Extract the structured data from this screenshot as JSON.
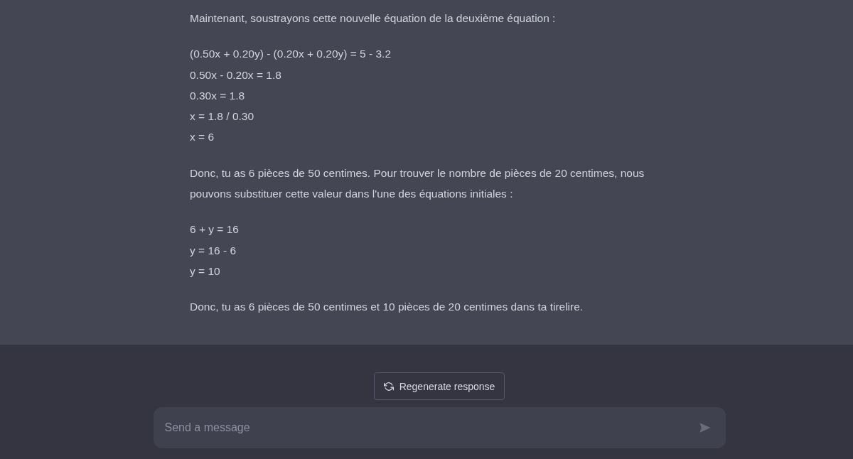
{
  "message": {
    "blocks": [
      {
        "kind": "paragraph",
        "text": "Maintenant, soustrayons cette nouvelle équation de la deuxième équation :"
      },
      {
        "kind": "lines",
        "lines": [
          "(0.50x + 0.20y) - (0.20x + 0.20y) = 5 - 3.2",
          "0.50x - 0.20x = 1.8",
          "0.30x = 1.8",
          "x = 1.8 / 0.30",
          "x = 6"
        ]
      },
      {
        "kind": "paragraph",
        "text": "Donc, tu as 6 pièces de 50 centimes. Pour trouver le nombre de pièces de 20 centimes, nous pouvons substituer cette valeur dans l'une des équations initiales :"
      },
      {
        "kind": "lines",
        "lines": [
          "6 + y = 16",
          "y = 16 - 6",
          "y = 10"
        ]
      },
      {
        "kind": "paragraph",
        "text": "Donc, tu as 6 pièces de 50 centimes et 10 pièces de 20 centimes dans ta tirelire."
      }
    ]
  },
  "regenerate_button": {
    "label": "Regenerate response"
  },
  "composer": {
    "placeholder": "Send a message"
  }
}
